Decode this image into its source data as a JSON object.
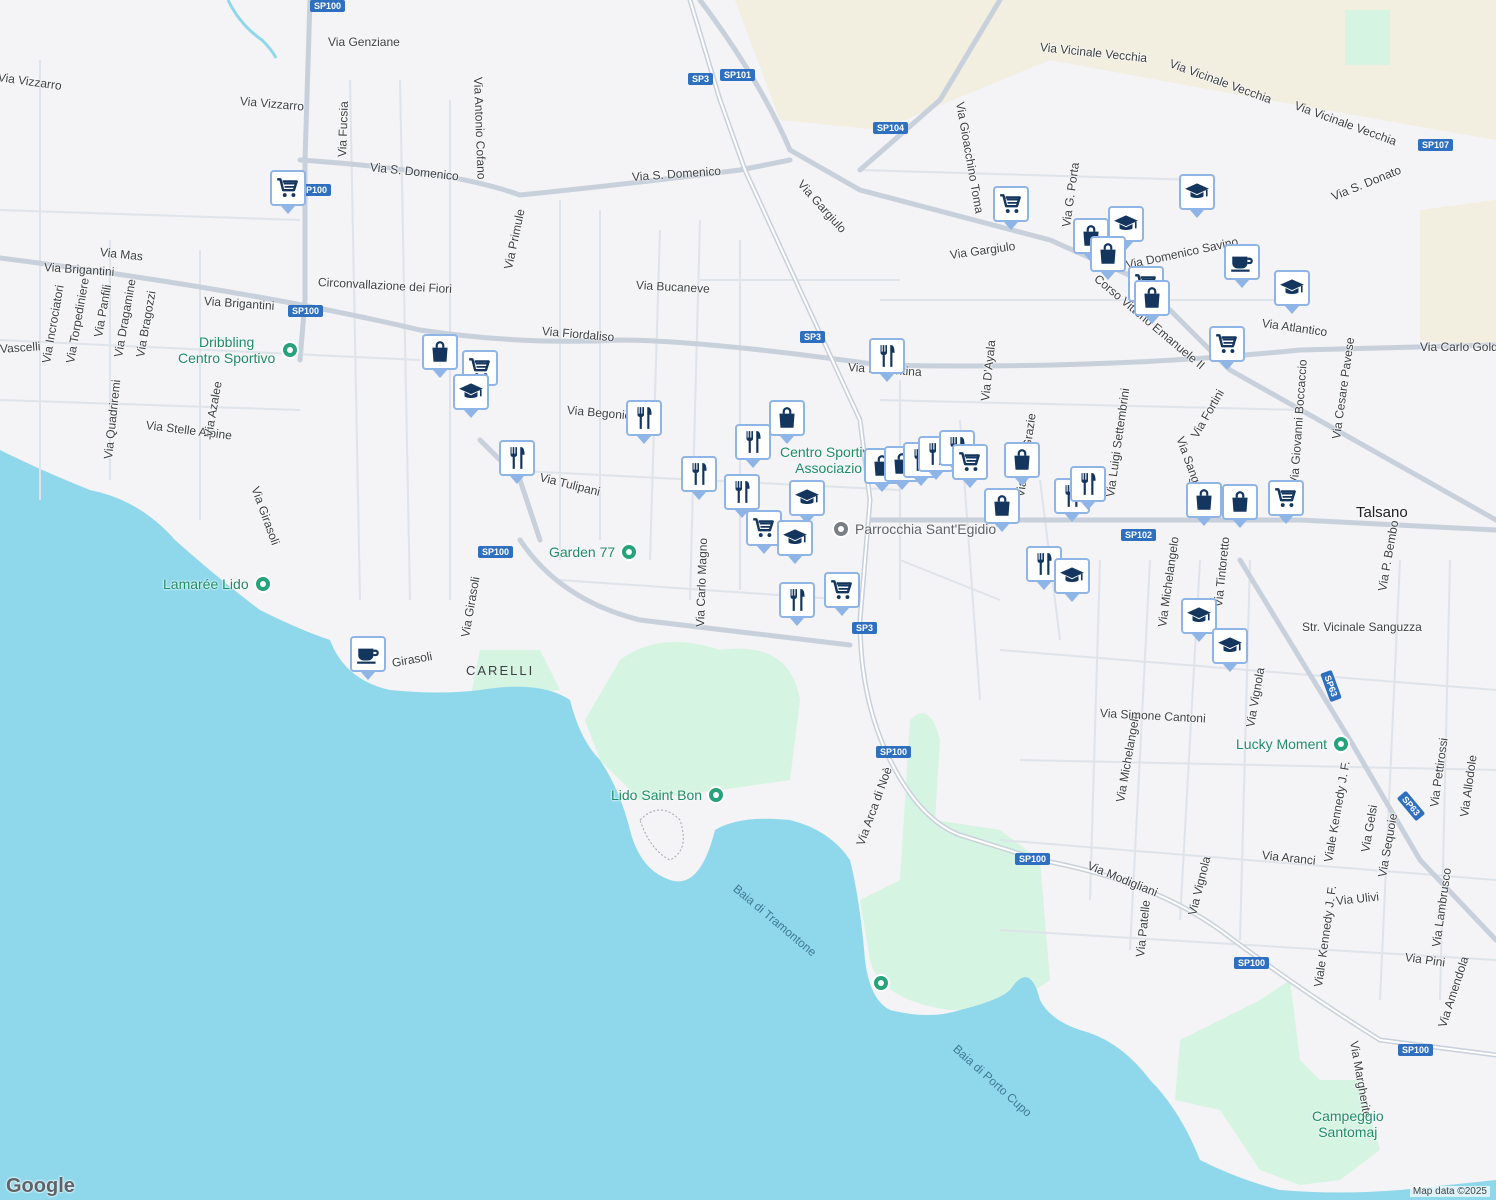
{
  "colors": {
    "land": "#f4f3f5",
    "water": "#8fd8ec",
    "park": "#d6f4e2",
    "farmland": "#f2eee0",
    "road": "#d4d9e3",
    "road_major": "#b9c3d1",
    "shield": "#2f6fc0",
    "poi_green": "#26a37a",
    "marker_icon": "#14365e",
    "marker_border": "#8fb4e6"
  },
  "streets": [
    "Via Genziane",
    "Via Vizzarro",
    "Via Vizzarro",
    "Via S. Domenico",
    "Via S. Domenico",
    "Via Mas",
    "Via Brigantini",
    "Via Brigantini",
    "Circonvallazione dei Fiori",
    "Via Fiordaliso",
    "Via Begonie",
    "Via Tulipani",
    "Via Stelle Alpine",
    "Via Girasoli",
    "Via Girasoli",
    "Girasoli",
    "Via Bucaneve",
    "Via Gargiulo",
    "Via Gargiulo",
    "Via Primule",
    "Via Fucsia",
    "Via Antonio Cofano",
    "Via Carlo Magno",
    "Via Arca di Noè",
    "Via Vicinale Vecchia",
    "Via Vicinale Vecchia",
    "Via Vicinale Vecchia",
    "Via Gioacchino Toma",
    "Via G. Porta",
    "Via Domenico Savino",
    "Corso Vittorio Emanuele II",
    "Via Atlantico",
    "Via Carlo Goldo",
    "Via S. Donato",
    "Via D'Ayala",
    "Via Luigi Settembrini",
    "Via Sanguzzo",
    "Via Fortini",
    "Via Giovanni Boccaccio",
    "Via Cesare Pavese",
    "Via Michelangelo",
    "Via Michelangelo",
    "Str. Vicinale Sanguzza",
    "Via Simone Cantoni",
    "Via Vignola",
    "Via Vignola",
    "Via Modigliani",
    "Via Aranci",
    "Via Ulivi",
    "Via Pini",
    "Via Patelle",
    "Viale Kennedy J. F.",
    "Viale Kennedy J. F.",
    "Via Gelsi",
    "Via Sequoie",
    "Via Pettirossi",
    "Via Allodole",
    "Via Lambrusco",
    "Via Amendola",
    "Via Margherite",
    "Via P. Bembo",
    "Via Azalee",
    "Via Quadriremi",
    "Via Incrociatori",
    "Via Torpediniere",
    "Via Panfili",
    "Via Dragamine",
    "Via Bragozzi",
    "Vascelli",
    "Via Tintoretto",
    "Via Fiorentina",
    "Via delle Grazie"
  ],
  "shields": [
    "SP100",
    "SP100",
    "SP100",
    "SP100",
    "SP100",
    "SP100",
    "SP100",
    "SP100",
    "SP3",
    "SP3",
    "SP3",
    "SP101",
    "SP104",
    "SP102",
    "SP107",
    "SP63",
    "SP63"
  ],
  "places": {
    "town": "Talsano",
    "area": "CARELLI",
    "water": [
      "Baia di Tramontone",
      "Baia di Porto Cupo"
    ]
  },
  "pois": [
    {
      "line1": "Dribbling",
      "line2": "Centro Sportivo"
    },
    {
      "name": "Lamarée Lido"
    },
    {
      "name": "Garden 77"
    },
    {
      "name": "Lido Saint Bon"
    },
    {
      "name": "Lucky Moment"
    },
    {
      "line1": "Campeggio",
      "line2": "Santomaj"
    },
    {
      "line1": "Centro Sportivo",
      "line2": "Associazio"
    },
    {
      "name": "Parrocchia Sant'Egidio"
    }
  ],
  "markers": {
    "types": {
      "cart": "shopping-cart-icon",
      "bag": "shopping-bag-icon",
      "fork": "restaurant-icon",
      "cap": "school-icon",
      "cup": "cafe-icon"
    }
  },
  "attribution": "Map data ©2025",
  "logo": "Google"
}
